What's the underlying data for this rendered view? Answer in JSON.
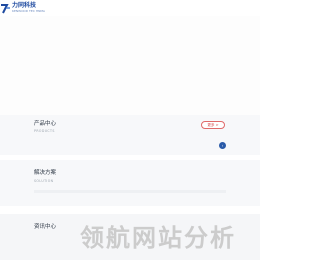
{
  "header": {
    "logo_cn": "力同科技",
    "logo_en": "KENWOOD TEC HNMA"
  },
  "products": {
    "title": "产品中心",
    "subtitle": "PRODUCTS",
    "more_label": "更多 >",
    "nav_arrow": "›"
  },
  "solutions": {
    "title": "解决方案",
    "subtitle": "SOLUTION"
  },
  "news": {
    "title": "资讯中心"
  },
  "watermark": {
    "text": "领航网站分析"
  },
  "colors": {
    "brand": "#1e4aa0",
    "accent_red": "#d64a4a",
    "nav_dot": "#2a5aa8"
  }
}
